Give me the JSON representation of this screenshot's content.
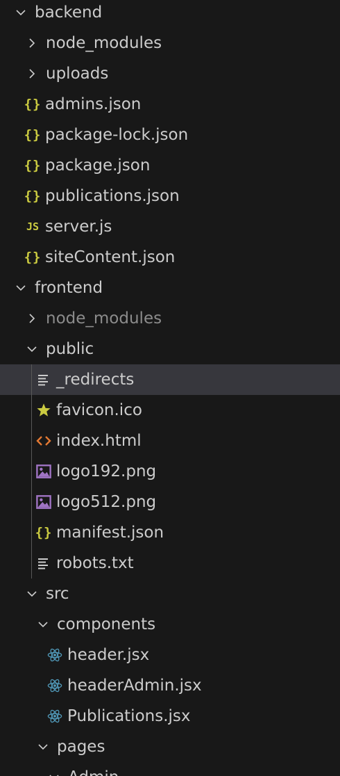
{
  "explorer": {
    "items": [
      {
        "label": "backend",
        "kind": "folder-open",
        "depth": 0
      },
      {
        "label": "node_modules",
        "kind": "folder-closed",
        "depth": 1
      },
      {
        "label": "uploads",
        "kind": "folder-closed",
        "depth": 1
      },
      {
        "label": "admins.json",
        "kind": "json",
        "depth": 1
      },
      {
        "label": "package-lock.json",
        "kind": "json",
        "depth": 1
      },
      {
        "label": "package.json",
        "kind": "json",
        "depth": 1
      },
      {
        "label": "publications.json",
        "kind": "json",
        "depth": 1
      },
      {
        "label": "server.js",
        "kind": "js",
        "depth": 1
      },
      {
        "label": "siteContent.json",
        "kind": "json",
        "depth": 1
      },
      {
        "label": "frontend",
        "kind": "folder-open",
        "depth": 0
      },
      {
        "label": "node_modules",
        "kind": "folder-closed",
        "depth": 1,
        "dimmed": true
      },
      {
        "label": "public",
        "kind": "folder-open",
        "depth": 1
      },
      {
        "label": "_redirects",
        "kind": "text",
        "depth": 2,
        "selected": true
      },
      {
        "label": "favicon.ico",
        "kind": "star",
        "depth": 2
      },
      {
        "label": "index.html",
        "kind": "html",
        "depth": 2
      },
      {
        "label": "logo192.png",
        "kind": "image",
        "depth": 2
      },
      {
        "label": "logo512.png",
        "kind": "image",
        "depth": 2
      },
      {
        "label": "manifest.json",
        "kind": "json",
        "depth": 2
      },
      {
        "label": "robots.txt",
        "kind": "text",
        "depth": 2
      },
      {
        "label": "src",
        "kind": "folder-open",
        "depth": 1
      },
      {
        "label": "components",
        "kind": "folder-open",
        "depth": 2
      },
      {
        "label": "header.jsx",
        "kind": "react",
        "depth": 3
      },
      {
        "label": "headerAdmin.jsx",
        "kind": "react",
        "depth": 3
      },
      {
        "label": "Publications.jsx",
        "kind": "react",
        "depth": 3
      },
      {
        "label": "pages",
        "kind": "folder-open",
        "depth": 2
      },
      {
        "label": "Admin",
        "kind": "folder-open",
        "depth": 3
      }
    ],
    "icons": {
      "folder-open": "chevron-down-icon",
      "folder-closed": "chevron-right-icon",
      "json": "json-braces-icon",
      "js": "javascript-icon",
      "text": "text-lines-icon",
      "star": "star-icon",
      "html": "html-code-icon",
      "image": "image-icon",
      "react": "react-atom-icon"
    },
    "colors": {
      "background": "#181818",
      "selected_row": "#37373d",
      "text": "#cccccc",
      "dimmed_text": "#8c8c8c",
      "json_icon": "#cbcb41",
      "star_icon": "#cbcb41",
      "html_icon": "#e37933",
      "image_icon": "#a074c4",
      "react_icon": "#519aba",
      "indent_guide": "#585858"
    }
  }
}
